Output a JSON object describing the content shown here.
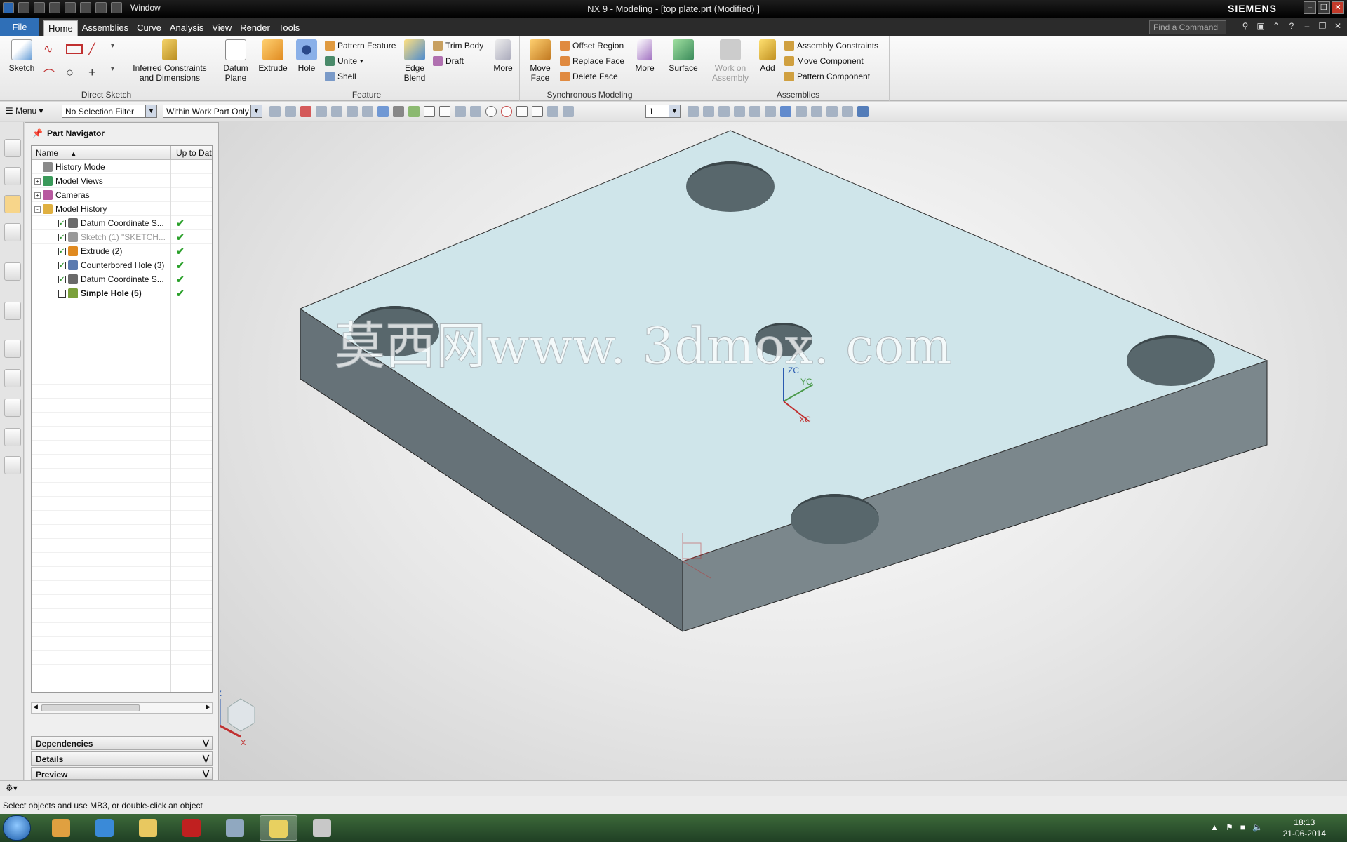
{
  "titlebar": {
    "title": "NX 9 - Modeling - [top plate.prt (Modified) ]",
    "brand": "SIEMENS",
    "window_menu": "Window"
  },
  "menu": {
    "file": "File",
    "tabs": [
      "Home",
      "Assemblies",
      "Curve",
      "Analysis",
      "View",
      "Render",
      "Tools"
    ],
    "find_placeholder": "Find a Command"
  },
  "ribbon": {
    "direct_sketch": {
      "label": "Direct Sketch",
      "sketch": "Sketch",
      "inferred": "Inferred Constraints and Dimensions"
    },
    "feature": {
      "label": "Feature",
      "datum_plane": "Datum Plane",
      "extrude": "Extrude",
      "hole": "Hole",
      "pattern_feature": "Pattern Feature",
      "unite": "Unite",
      "shell": "Shell",
      "edge_blend": "Edge Blend",
      "trim_body": "Trim Body",
      "draft": "Draft",
      "more": "More"
    },
    "sync": {
      "label": "Synchronous Modeling",
      "move_face": "Move Face",
      "offset_region": "Offset Region",
      "replace_face": "Replace Face",
      "delete_face": "Delete Face",
      "more": "More"
    },
    "surface": {
      "label": "Surface"
    },
    "assemblies": {
      "label": "Assemblies",
      "work_on_assembly": "Work on Assembly",
      "add": "Add",
      "assembly_constraints": "Assembly Constraints",
      "move_component": "Move Component",
      "pattern_component": "Pattern Component"
    }
  },
  "selection_bar": {
    "menu": "Menu",
    "filter": "No Selection Filter",
    "scope": "Within Work Part Only",
    "layer": "1"
  },
  "navigator": {
    "title": "Part Navigator",
    "columns": {
      "name": "Name",
      "status": "Up to Dat"
    },
    "rows": [
      {
        "label": "History Mode",
        "indent": 0,
        "expander": "",
        "checked": false,
        "tick": false,
        "style": "",
        "icon_color": "#8a8a8a"
      },
      {
        "label": "Model Views",
        "indent": 0,
        "expander": "+",
        "checked": false,
        "tick": false,
        "style": "",
        "icon_color": "#3a9a5a"
      },
      {
        "label": "Cameras",
        "indent": 0,
        "expander": "+",
        "checked": false,
        "tick": false,
        "style": "",
        "icon_color": "#b85aa0"
      },
      {
        "label": "Model History",
        "indent": 0,
        "expander": "-",
        "checked": false,
        "tick": false,
        "style": "",
        "icon_color": "#e0b040"
      },
      {
        "label": "Datum Coordinate S...",
        "indent": 1,
        "expander": "",
        "checked": true,
        "tick": true,
        "style": "",
        "icon_color": "#6a6a6a"
      },
      {
        "label": "Sketch (1) \"SKETCH...",
        "indent": 1,
        "expander": "",
        "checked": true,
        "tick": true,
        "style": "dim",
        "icon_color": "#9a9a9a"
      },
      {
        "label": "Extrude (2)",
        "indent": 1,
        "expander": "",
        "checked": true,
        "tick": true,
        "style": "",
        "icon_color": "#e08a20"
      },
      {
        "label": "Counterbored Hole (3)",
        "indent": 1,
        "expander": "",
        "checked": true,
        "tick": true,
        "style": "",
        "icon_color": "#5a7ab0"
      },
      {
        "label": "Datum Coordinate S...",
        "indent": 1,
        "expander": "",
        "checked": true,
        "tick": true,
        "style": "",
        "icon_color": "#6a6a6a"
      },
      {
        "label": "Simple Hole (5)",
        "indent": 1,
        "expander": "",
        "checked": false,
        "tick": true,
        "style": "bold",
        "icon_color": "#7aa03a"
      }
    ],
    "panels": [
      "Dependencies",
      "Details",
      "Preview"
    ]
  },
  "viewport": {
    "watermark": "莫西网www. 3dmox. com",
    "axis_labels": {
      "zc": "ZC",
      "yc": "YC",
      "xc": "XC",
      "z": "Z",
      "x": "X"
    }
  },
  "status": {
    "message": "Select objects and use MB3, or double-click an object"
  },
  "taskbar": {
    "time": "18:13",
    "date": "21-06-2014"
  }
}
